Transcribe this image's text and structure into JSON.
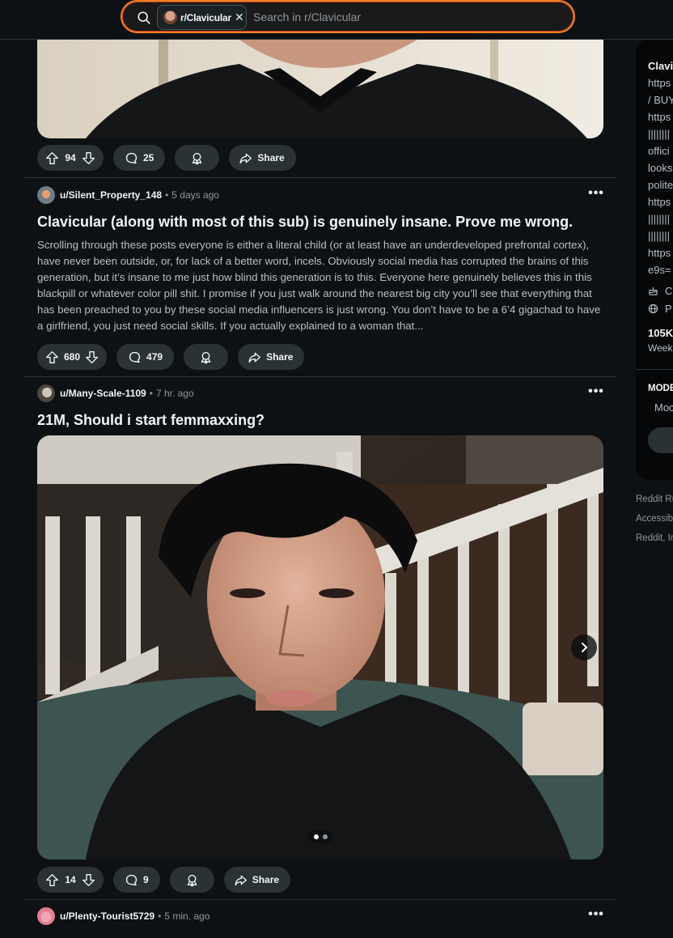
{
  "search": {
    "chip_label": "r/Clavicular",
    "placeholder": "Search in r/Clavicular"
  },
  "posts": [
    {
      "upvotes": "94",
      "comments": "25",
      "share_label": "Share"
    },
    {
      "user": "u/Silent_Property_148",
      "time": "5 days ago",
      "title": "Clavicular (along with most of this sub) is genuinely insane. Prove me wrong.",
      "body": "Scrolling through these posts everyone is either a literal child (or at least have an underdeveloped prefrontal cortex), have never been outside, or, for lack of a better word, incels. Obviously social media has corrupted the brains of this generation, but it’s insane to me just how blind this generation is to this. Everyone here genuinely believes this in this blackpill or whatever color pill shit. I promise if you just walk around the nearest big city you’ll see that everything that has been preached to you by these social media influencers is just wrong. You don’t have to be a 6’4 gigachad to have a girlfriend, you just need social skills. If you actually explained to a woman that...",
      "upvotes": "680",
      "comments": "479",
      "share_label": "Share"
    },
    {
      "user": "u/Many-Scale-1109",
      "time": "7 hr. ago",
      "title": "21M, Should i start femmaxxing?",
      "upvotes": "14",
      "comments": "9",
      "share_label": "Share",
      "carousel": {
        "current": 1,
        "total": 2
      }
    },
    {
      "user": "u/Plenty-Tourist5729",
      "time": "5 min. ago"
    }
  ],
  "meta_separator": "•",
  "sidebar": {
    "lines": [
      "Clavi",
      "https",
      "/ BUY",
      "https",
      "||||||||",
      "offici",
      "looks",
      "polite",
      "https",
      "||||||||",
      "||||||||",
      "https",
      "e9s="
    ],
    "created_icon_label": "C",
    "public_icon_label": "P",
    "members": "105K",
    "members_label": "Week",
    "moderators_heading": "MODE",
    "moderators_link": "Moc"
  },
  "footer": {
    "links": [
      "Reddit Ru",
      "Accessibi",
      "Reddit, In"
    ]
  }
}
